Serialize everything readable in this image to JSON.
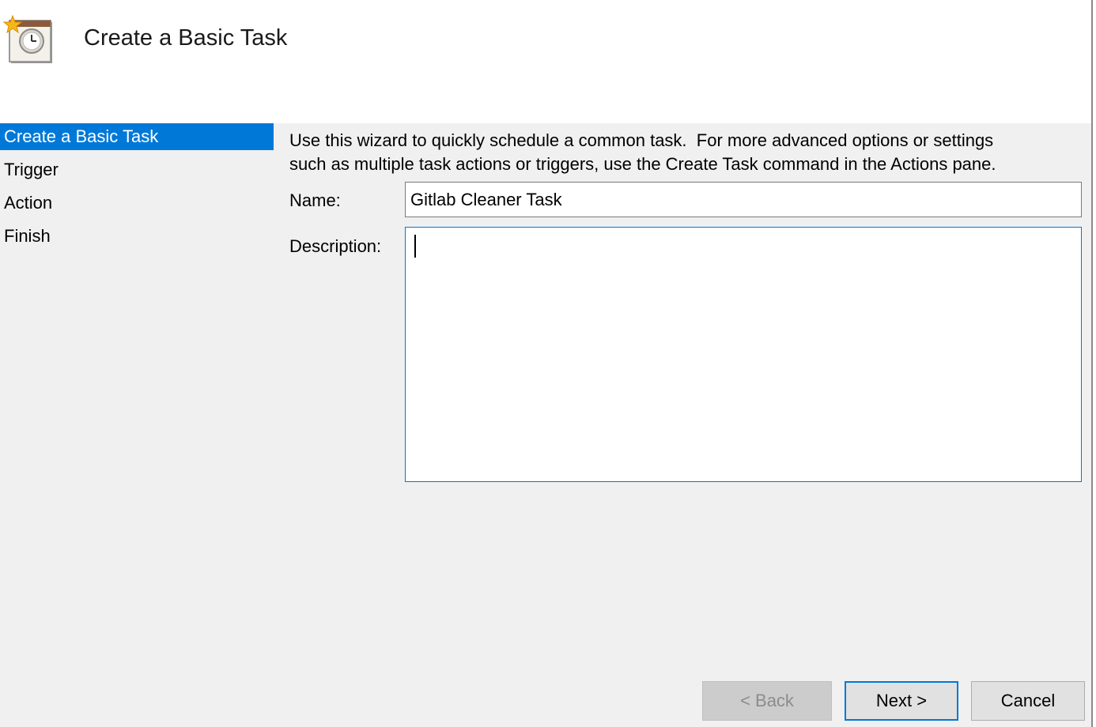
{
  "header": {
    "title": "Create a Basic Task",
    "icon": "scheduled-task-clock-icon"
  },
  "steps": [
    {
      "label": "Create a Basic Task",
      "active": true
    },
    {
      "label": "Trigger",
      "active": false
    },
    {
      "label": "Action",
      "active": false
    },
    {
      "label": "Finish",
      "active": false
    }
  ],
  "intro": {
    "line1": "Use this wizard to quickly schedule a common task.  For more advanced options or settings",
    "line2": "such as multiple task actions or triggers, use the Create Task command in the Actions pane."
  },
  "form": {
    "name_label": "Name:",
    "name_value": "Gitlab Cleaner Task",
    "description_label": "Description:",
    "description_value": ""
  },
  "buttons": {
    "back": "< Back",
    "next": "Next >",
    "cancel": "Cancel"
  },
  "colors": {
    "accent": "#0078d7",
    "background": "#f0f0f0"
  }
}
